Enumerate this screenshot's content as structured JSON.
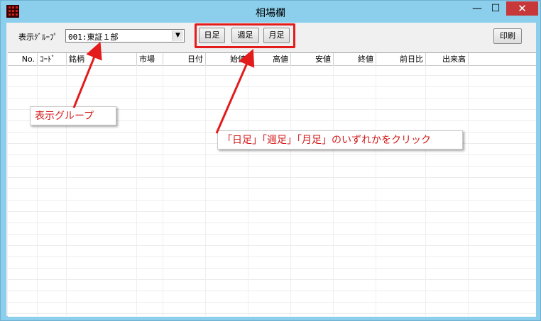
{
  "window": {
    "title": "相場欄",
    "min_label": "—",
    "max_label": "☐",
    "close_label": "✕"
  },
  "toolbar": {
    "group_label": "表示ｸﾞﾙｰﾌﾟ",
    "group_value": "001:東証１部",
    "day_button": "日足",
    "week_button": "週足",
    "month_button": "月足",
    "print_button": "印刷"
  },
  "table": {
    "columns": [
      "No.",
      "ｺｰﾄﾞ",
      "銘柄",
      "市場",
      "日付",
      "始値",
      "高値",
      "安値",
      "終値",
      "前日比",
      "出来高"
    ]
  },
  "annotations": {
    "group_callout": "表示グループ",
    "click_callout": "「日足」「週足」「月足」のいずれかをクリック"
  },
  "colors": {
    "accent_red": "#e31b1b",
    "titlebar": "#8ccfec",
    "close": "#c7383a"
  }
}
